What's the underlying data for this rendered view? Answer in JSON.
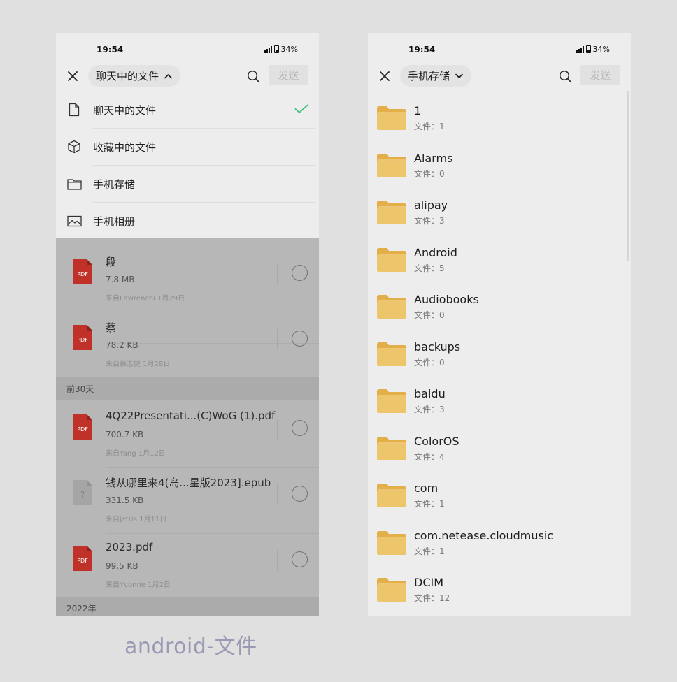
{
  "left": {
    "status": {
      "time": "19:54",
      "battery": "34%"
    },
    "picker_label": "聊天中的文件",
    "send_label": "发送",
    "menu": [
      {
        "label": "聊天中的文件",
        "icon": "document-icon",
        "selected": true
      },
      {
        "label": "收藏中的文件",
        "icon": "cube-icon",
        "selected": false
      },
      {
        "label": "手机存储",
        "icon": "folder-outline-icon",
        "selected": false
      },
      {
        "label": "手机相册",
        "icon": "image-icon",
        "selected": false
      }
    ],
    "files_a": [
      {
        "name": "段",
        "size": "7.8 MB",
        "from": "来自Lawrenchi  1月29日",
        "type": "pdf"
      },
      {
        "name": "蔡",
        "size": "78.2 KB",
        "from": "来自蔡志健  1月28日",
        "type": "pdf"
      }
    ],
    "section_30": "前30天",
    "files_b": [
      {
        "name": "4Q22Presentati...(C)WoG (1).pdf",
        "size": "700.7 KB",
        "from": "来自Yang  1月12日",
        "type": "pdf"
      },
      {
        "name": "钱从哪里来4(岛...星版2023].epub",
        "size": "331.5 KB",
        "from": "来自jetris  1月11日",
        "type": "unknown"
      },
      {
        "name": "2023.pdf",
        "size": "99.5 KB",
        "from": "来自Yvonne  1月2日",
        "type": "pdf"
      }
    ],
    "section_2022": "2022年",
    "pdf_badge": "PDF",
    "unknown_badge": "?"
  },
  "right": {
    "status": {
      "time": "19:54",
      "battery": "34%"
    },
    "picker_label": "手机存储",
    "send_label": "发送",
    "folders": [
      {
        "name": "1",
        "count": "文件：1"
      },
      {
        "name": "Alarms",
        "count": "文件：0"
      },
      {
        "name": "alipay",
        "count": "文件：3"
      },
      {
        "name": "Android",
        "count": "文件：5"
      },
      {
        "name": "Audiobooks",
        "count": "文件：0"
      },
      {
        "name": "backups",
        "count": "文件：0"
      },
      {
        "name": "baidu",
        "count": "文件：3"
      },
      {
        "name": "ColorOS",
        "count": "文件：4"
      },
      {
        "name": "com",
        "count": "文件：1"
      },
      {
        "name": "com.netease.cloudmusic",
        "count": "文件：1"
      },
      {
        "name": "DCIM",
        "count": "文件：12"
      }
    ]
  },
  "caption": "android-文件",
  "colors": {
    "folder": "#e9bd5c",
    "pdf": "#c0312a",
    "check": "#3fbf7c"
  }
}
